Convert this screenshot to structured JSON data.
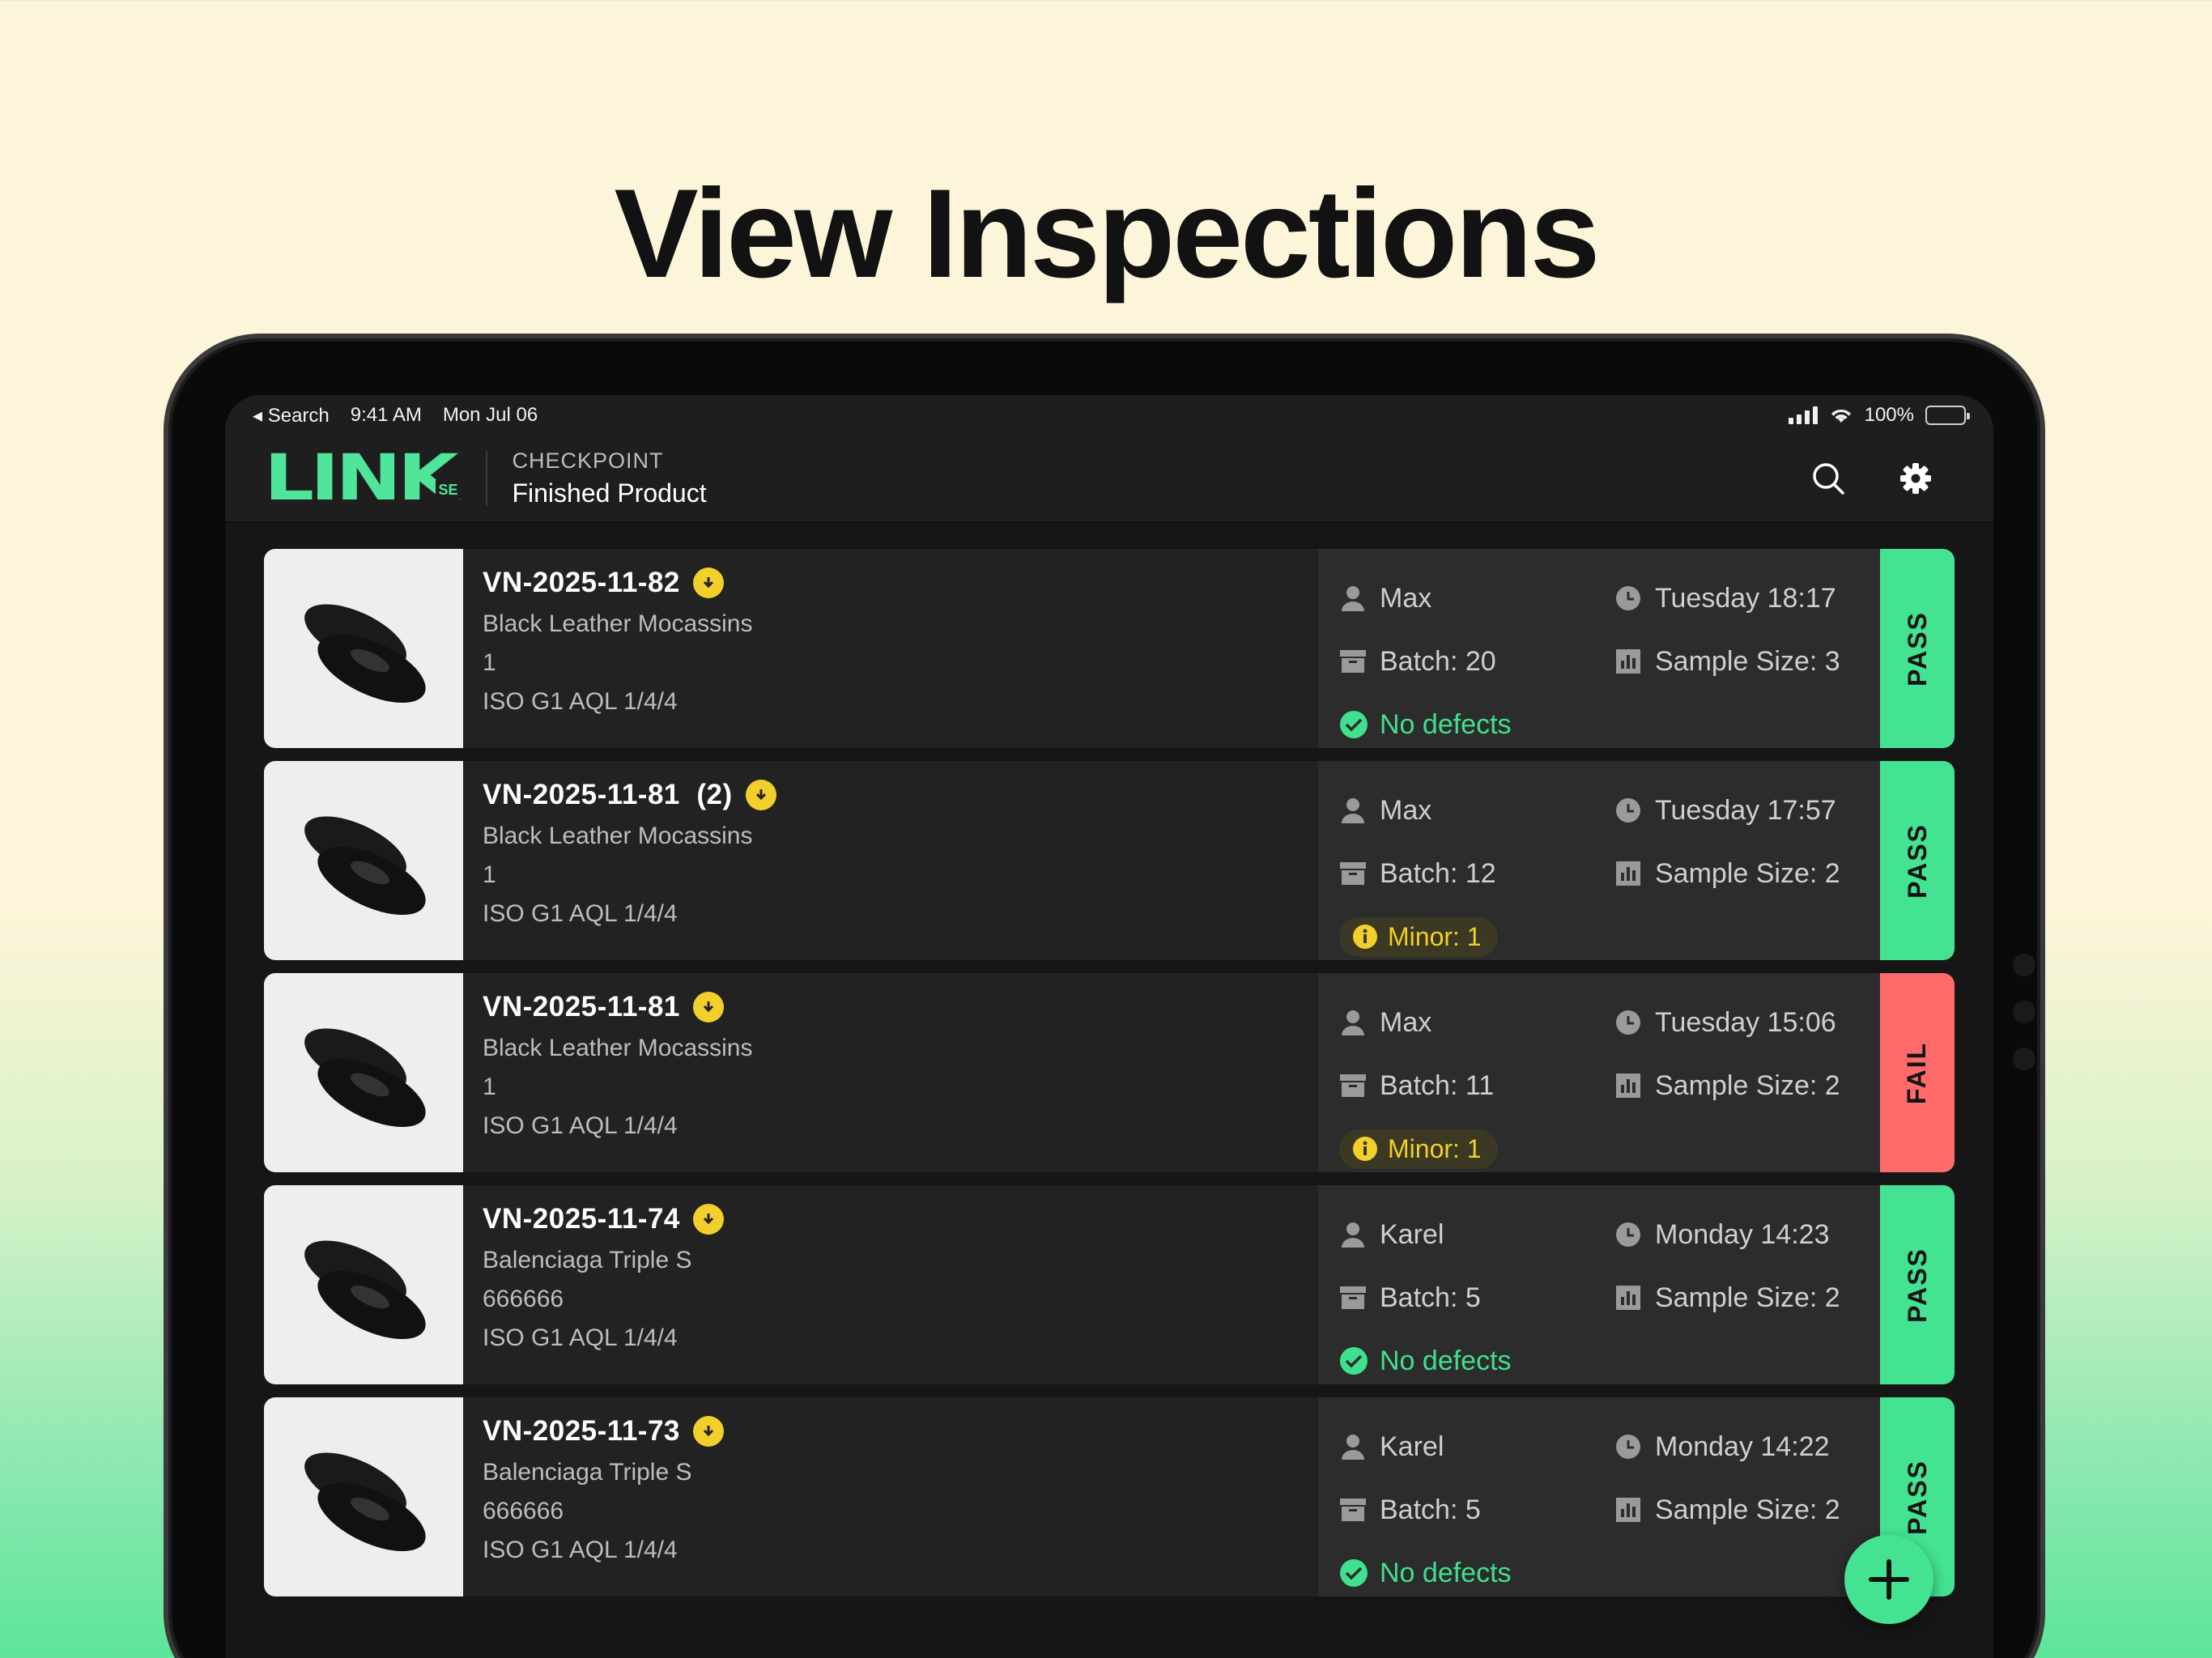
{
  "headline": "View Inspections",
  "statusbar": {
    "back_label": "◂ Search",
    "time": "9:41 AM",
    "date": "Mon Jul 06",
    "battery": "100%"
  },
  "appbar": {
    "logo": "LINK",
    "logo_badge": "SE",
    "subtitle": "CHECKPOINT",
    "title": "Finished Product"
  },
  "inspections": [
    {
      "ref": "VN-2025-11-82",
      "product": "Black Leather Mocassins",
      "qty": "1",
      "standard": "ISO G1 AQL  1/4/4",
      "inspector": "Max",
      "time": "Tuesday 18:17",
      "batch": "Batch: 20",
      "sample": "Sample Size: 3",
      "defects": "No defects",
      "status": "PASS"
    },
    {
      "ref": "VN-2025-11-81  (2)",
      "product": "Black Leather Mocassins",
      "qty": "1",
      "standard": "ISO G1 AQL  1/4/4",
      "inspector": "Max",
      "time": "Tuesday 17:57",
      "batch": "Batch: 12",
      "sample": "Sample Size: 2",
      "defects": "Minor: 1",
      "status": "PASS"
    },
    {
      "ref": "VN-2025-11-81",
      "product": "Black Leather Mocassins",
      "qty": "1",
      "standard": "ISO G1 AQL  1/4/4",
      "inspector": "Max",
      "time": "Tuesday 15:06",
      "batch": "Batch: 11",
      "sample": "Sample Size: 2",
      "defects": "Minor: 1",
      "status": "FAIL"
    },
    {
      "ref": "VN-2025-11-74",
      "product": "Balenciaga Triple S",
      "qty": "666666",
      "standard": "ISO G1 AQL  1/4/4",
      "inspector": "Karel",
      "time": "Monday 14:23",
      "batch": "Batch: 5",
      "sample": "Sample Size: 2",
      "defects": "No defects",
      "status": "PASS"
    },
    {
      "ref": "VN-2025-11-73",
      "product": "Balenciaga Triple S",
      "qty": "666666",
      "standard": "ISO G1 AQL  1/4/4",
      "inspector": "Karel",
      "time": "Monday 14:22",
      "batch": "Batch: 5",
      "sample": "Sample Size: 2",
      "defects": "No defects",
      "status": "PASS"
    }
  ],
  "colors": {
    "accent": "#43e391",
    "fail": "#ff6b6b",
    "warning": "#f2cf2a"
  }
}
